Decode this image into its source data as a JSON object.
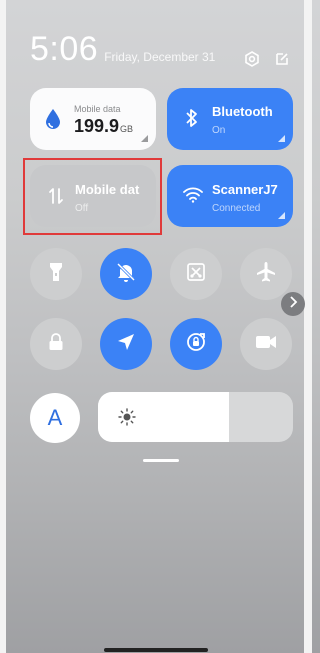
{
  "header": {
    "time": "5:06",
    "date": "Friday, December 31",
    "icons": [
      "settings-icon",
      "edit-icon"
    ]
  },
  "tiles": {
    "mobile_data_usage": {
      "label": "Mobile data",
      "value": "199.9",
      "unit": "GB",
      "icon": "water-drop-icon"
    },
    "bluetooth": {
      "label": "Bluetooth",
      "status": "On",
      "icon": "bluetooth-icon"
    },
    "mobile_data": {
      "label": "Mobile dat",
      "status": "Off",
      "icon": "data-transfer-icon"
    },
    "wifi": {
      "label": "ScannerJ7",
      "status": "Connected",
      "icon": "wifi-icon"
    }
  },
  "toggles_row1": [
    {
      "icon": "flashlight-icon",
      "active": false
    },
    {
      "icon": "mute-bell-icon",
      "active": true
    },
    {
      "icon": "screenshot-icon",
      "active": false
    },
    {
      "icon": "airplane-icon",
      "active": false
    }
  ],
  "toggles_row2": [
    {
      "icon": "lock-icon",
      "active": false
    },
    {
      "icon": "location-icon",
      "active": true
    },
    {
      "icon": "auto-rotate-icon",
      "active": true
    },
    {
      "icon": "video-camera-icon",
      "active": false
    }
  ],
  "font_button": {
    "label": "A"
  },
  "brightness": {
    "level": 0.67
  },
  "colors": {
    "accent": "#3b82f6",
    "highlight": "#e03a3a"
  }
}
